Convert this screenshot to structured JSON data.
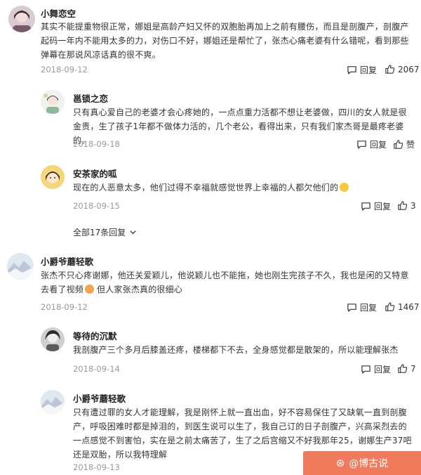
{
  "comments": [
    {
      "username": "小舞恋空",
      "content": "其实不能提重物很正常，娜姐是高龄产妇又怀的双胞胎再加上之前有腰伤，而且是剖腹产，剖腹产起码一年内不能用太多的力，对伤口不好，娜姐还是帮忙了，张杰心痛老婆有什么错呢，看到那些弹幕在那说风凉话真的很不爽。",
      "date": "2018-09-12",
      "reply_label": "回复",
      "likes": "2067"
    },
    {
      "username": "邕锁之恋",
      "content": "只有真心爱自己的老婆才会心疼她的，一点点重力活都不想让老婆做，四川的女人就是很金贵，生了孩子1年都不做体力活的，几个老公，看得出来，只有我们家杰哥是最疼老婆的。",
      "date": "2018-09-18",
      "reply_label": "回复",
      "likes": "赞"
    },
    {
      "username": "安茶家的呱",
      "content": "现在的人恶意太多，他们过得不幸福就感觉世界上幸福的人都欠他们的",
      "date": "2018-09-15",
      "reply_label": "回复",
      "likes": "3"
    },
    {
      "username": "小爵爷蘑轻歌",
      "content_before": "张杰不只心疼谢娜，他还关爱颖儿，他说颖儿也不能拖，她也刚生完孩子不久，我也是闲的又特意去看了视频",
      "content_after": "但人家张杰真的很细心",
      "date": "2018-09-12",
      "reply_label": "回复",
      "likes": "1467"
    },
    {
      "username": "等待的沉默",
      "content": "我剖腹产三个多月后膝盖还疼，楼梯都下不去，全身感觉都是散架的，所以能理解张杰",
      "date": "2018-09-14",
      "reply_label": "回复",
      "likes": "7"
    },
    {
      "username": "小爵爷蘑轻歌",
      "content": "只有遭过罪的女人才能理解，我是刚怀上就一直出血，好不容易保住了又缺氧一直到剖腹产，呼吸困难时都是掉泪的，到医生说可以生了，我自己订的日子剖腹产，兴高采烈去的一点感觉不到害怕，实在是之前太痛苦了，生了之后宫缩又不好我那年25，谢娜生产37吧还是双胎，所以我特理解",
      "date": "2018-09-13"
    }
  ],
  "expand_replies": "全部17条回复",
  "watermark": {
    "text": "@博古说"
  },
  "icons": {
    "reply": "reply-icon",
    "like": "thumbs-up-icon",
    "expand": "chevron-down-icon"
  }
}
